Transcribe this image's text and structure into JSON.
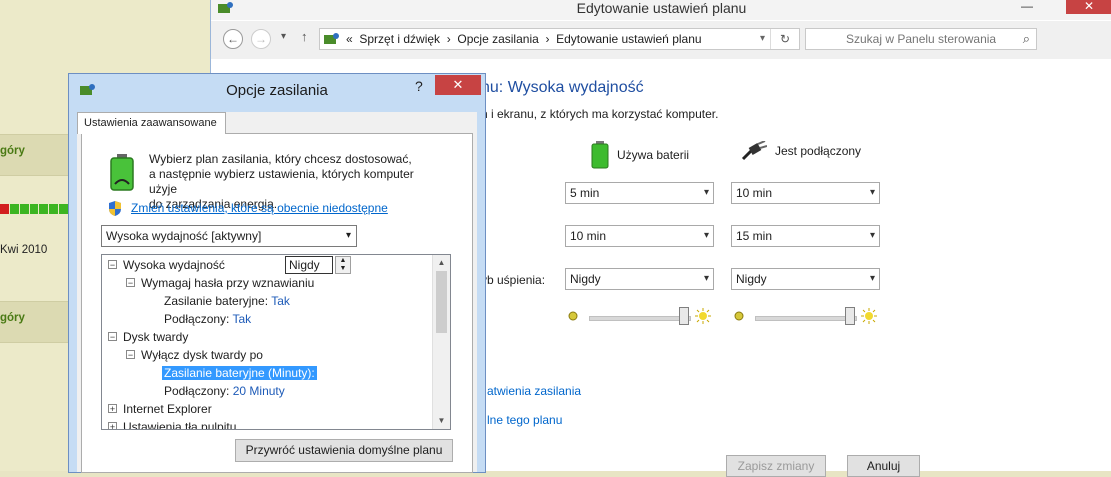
{
  "background": {
    "labels": [
      "góry",
      "Kwi 2010",
      "góry"
    ]
  },
  "main_window": {
    "title": "Edytowanie ustawień planu",
    "minimize": "—",
    "close": "✕",
    "breadcrumb": [
      "«",
      "Sprzęt i dźwięk",
      "›",
      "Opcje zasilania",
      "›",
      "Edytowanie ustawień planu"
    ],
    "search_placeholder": "Szukaj w Panelu sterowania",
    "heading": "nu: Wysoka wydajność",
    "description": "n i ekranu, z których ma korzystać komputer.",
    "col_battery": "Używa baterii",
    "col_plugged": "Jest podłączony",
    "rows": [
      {
        "label": "",
        "battery": "5 min",
        "plugged": "10 min"
      },
      {
        "label": "",
        "battery": "10 min",
        "plugged": "15 min"
      },
      {
        "label": "yb uśpienia:",
        "battery": "Nigdy",
        "plugged": "Nigdy"
      }
    ],
    "link_power": "atwienia zasilania",
    "link_restore": "lne tego planu",
    "save_label": "Zapisz zmiany",
    "cancel_label": "Anuluj"
  },
  "dialog": {
    "title": "Opcje zasilania",
    "help": "?",
    "close": "✕",
    "tab": "Ustawienia zaawansowane",
    "intro_1": "Wybierz plan zasilania, który chcesz dostosować,",
    "intro_2": "a następnie wybierz ustawienia, których komputer użyje",
    "intro_3": "do zarządzania energią.",
    "change_link": "Zmień ustawienia, które są obecnie niedostępne",
    "plan_value": "Wysoka wydajność [aktywny]",
    "tree": {
      "n1": "Wysoka wydajność",
      "n2": "Wymagaj hasła przy wznawianiu",
      "n2a_label": "Zasilanie bateryjne:",
      "n2a_val": "Tak",
      "n2b_label": "Podłączony:",
      "n2b_val": "Tak",
      "n3": "Dysk twardy",
      "n4": "Wyłącz dysk twardy po",
      "n4a_label": "Zasilanie bateryjne (Minuty):",
      "n4a_input": "Nigdy",
      "n4b_label": "Podłączony:",
      "n4b_val": "20 Minuty",
      "n5": "Internet Explorer",
      "n6": "Ustawienia tła pulpitu"
    },
    "restore_button": "Przywróć ustawienia domyślne planu"
  }
}
